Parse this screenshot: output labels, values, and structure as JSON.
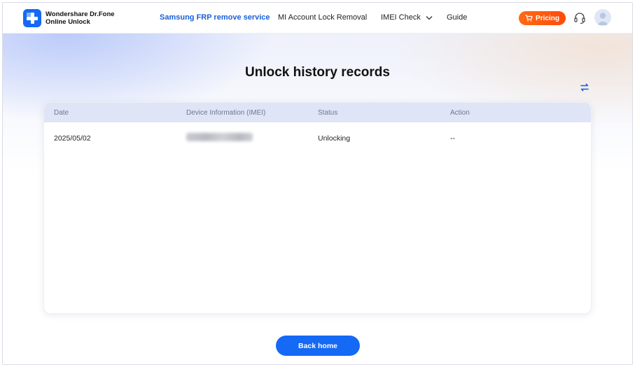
{
  "brand": {
    "name_line1": "Wondershare Dr.Fone",
    "name_line2": "Online Unlock",
    "color": "#1469f5"
  },
  "nav": {
    "items": [
      {
        "label": "Samsung FRP remove service",
        "active": true
      },
      {
        "label": "MI Account Lock Removal",
        "active": false
      },
      {
        "label": "IMEI Check",
        "active": false,
        "has_dropdown": true
      },
      {
        "label": "Guide",
        "active": false
      }
    ],
    "pricing_label": "Pricing",
    "pricing_color": "#ff5a0f",
    "support_icon": "headset-icon",
    "avatar_icon": "user-avatar-icon"
  },
  "page": {
    "title": "Unlock history records",
    "refresh_icon": "refresh-icon"
  },
  "table": {
    "columns": [
      "Date",
      "Device Information (IMEI)",
      "Status",
      "Action"
    ],
    "rows": [
      {
        "date": "2025/05/02",
        "imei": "[blurred]",
        "status": "Unlocking",
        "action": "--"
      }
    ],
    "header_color": "#dfe4f6"
  },
  "footer": {
    "back_home_label": "Back home",
    "button_color": "#1469f5"
  }
}
